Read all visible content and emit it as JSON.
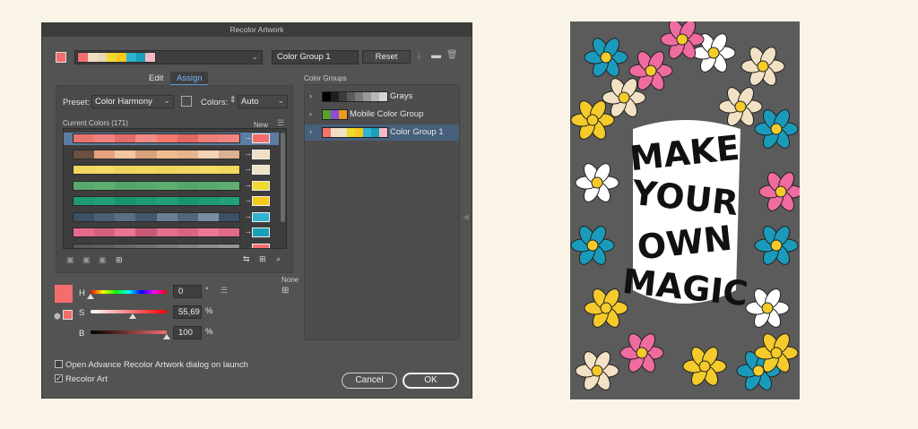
{
  "dialog": {
    "title": "Recolor Artwork",
    "group_name": "Color Group 1",
    "reset_label": "Reset",
    "tabs": {
      "edit": "Edit",
      "assign": "Assign"
    },
    "preset_label": "Preset:",
    "preset_value": "Color Harmony",
    "colors_label": "Colors:",
    "colors_value": "Auto",
    "current_colors_label": "Current Colors (171)",
    "new_label": "New",
    "none_label": "None",
    "hsb": {
      "h_label": "H",
      "h_value": "0",
      "h_unit": "°",
      "s_label": "S",
      "s_value": "55,69",
      "s_unit": "%",
      "b_label": "B",
      "b_value": "100",
      "b_unit": "%",
      "h_level": 0.0,
      "s_level": 0.5569,
      "b_level": 1.0
    },
    "open_advance_label": "Open Advance Recolor Artwork dialog on launch",
    "open_advance_checked": false,
    "recolor_art_label": "Recolor Art",
    "recolor_art_checked": true,
    "cancel_label": "Cancel",
    "ok_label": "OK",
    "color_groups_label": "Color Groups",
    "color_groups": [
      {
        "name": "Grays",
        "swatches": [
          "#000000",
          "#1f1f1f",
          "#3d3d3d",
          "#5c5c5c",
          "#7a7a7a",
          "#999999",
          "#b8b8b8",
          "#d6d6d6"
        ],
        "selected": false
      },
      {
        "name": "Mobile Color Group",
        "swatches": [
          "#5aa02c",
          "#8a4fd6",
          "#e89b1d"
        ],
        "selected": false
      },
      {
        "name": "Color Group 1",
        "swatches": [
          "#f4736e",
          "#f1dfc4",
          "#eee3c4",
          "#f2d92f",
          "#f7c91b",
          "#2fb3d3",
          "#1aa0b8",
          "#f6b9c7"
        ],
        "selected": true
      }
    ],
    "top_swatch": "#f46d6d",
    "top_strip": [
      "#f46d6d",
      "#f1dfc4",
      "#e8d6b4",
      "#f2d92f",
      "#f7c91b",
      "#2fb3d3",
      "#1aa0b8",
      "#f6b9c7"
    ],
    "big_swatch": "#f46d6d",
    "color_rows": [
      {
        "src": [
          "#e8746e",
          "#f08080",
          "#e26a68",
          "#f08a86",
          "#f2786e",
          "#e06860",
          "#ee7e78",
          "#f28480"
        ],
        "target": "#f46d6d",
        "selected": true
      },
      {
        "src": [
          "#6b5141",
          "#e9a27e",
          "#f2c7a2",
          "#d8a17a",
          "#f0be8e",
          "#e8b48b",
          "#f4d2b4",
          "#ddb091"
        ],
        "target": "#f1dfc4",
        "selected": false
      },
      {
        "src": [
          "#f2d760",
          "#f4da62",
          "#eed45c",
          "#f2d75e",
          "#f0d45a",
          "#f2d760",
          "#f4da62",
          "#f2d75e"
        ],
        "target": "#eee3c4",
        "selected": false
      },
      {
        "src": [
          "#5aa86b",
          "#5fae70",
          "#56a468",
          "#5aa86b",
          "#5fae70",
          "#56a468",
          "#5aa86b",
          "#5fae70"
        ],
        "target": "#f2d92f",
        "selected": false
      },
      {
        "src": [
          "#1d9a74",
          "#21a07a",
          "#1a9470",
          "#1d9a74",
          "#21a07a",
          "#1a9470",
          "#1d9a74",
          "#21a07a"
        ],
        "target": "#f7c91b",
        "selected": false
      },
      {
        "src": [
          "#3e4f63",
          "#4d5f74",
          "#5c6e84",
          "#44566b",
          "#6c7e94",
          "#52657a",
          "#7a8ca1",
          "#3e4f63"
        ],
        "target": "#2fb3d3",
        "selected": false
      },
      {
        "src": [
          "#e66b8a",
          "#d46080",
          "#ea7492",
          "#c75a7a",
          "#e56e8c",
          "#d96483",
          "#ec7896",
          "#e06a88"
        ],
        "target": "#1aa0b8",
        "selected": false
      },
      {
        "src": [
          "#585858",
          "#5e5e5e",
          "#676767",
          "#707070",
          "#7a7a7a",
          "#838383",
          "#8c8c8c",
          "#959595"
        ],
        "target": "#f46d6d",
        "selected": false
      }
    ]
  },
  "artwork": {
    "background": "#5b5b5b",
    "frame_bg": "#ffffff",
    "lines": [
      "MAKE",
      "YOUR",
      "OWN",
      "MAGIC"
    ],
    "flower_colors": [
      "#1a9bbb",
      "#f06ba0",
      "#f5cb2b",
      "#f2e1c4",
      "#ffffff"
    ]
  }
}
